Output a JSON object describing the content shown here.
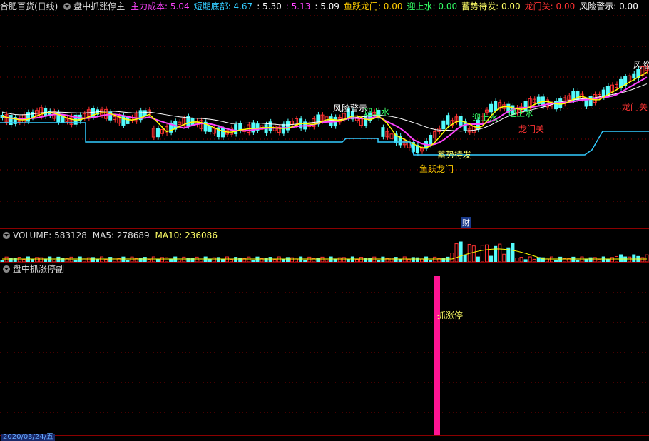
{
  "main_header": {
    "stock": "合肥百货(日线)",
    "indicator": "盘中抓涨停主",
    "items": [
      {
        "label": "主力成本:",
        "value": "5.04",
        "color": "#ff44ff"
      },
      {
        "label": "短期底部:",
        "value": "4.67",
        "color": "#33ccff"
      },
      {
        "label": ":",
        "value": "5.30",
        "color": "#ffffff"
      },
      {
        "label": ":",
        "value": "5.13",
        "color": "#ff44ff"
      },
      {
        "label": ":",
        "value": "5.09",
        "color": "#ffffff"
      },
      {
        "label": "鱼跃龙门:",
        "value": "0.00",
        "color": "#ffcc00"
      },
      {
        "label": "迎上水:",
        "value": "0.00",
        "color": "#33ff66"
      },
      {
        "label": "蓄势待发:",
        "value": "0.00",
        "color": "#ffff66"
      },
      {
        "label": "龙门关:",
        "value": "0.00",
        "color": "#ff3333"
      },
      {
        "label": "风险警示:",
        "value": "0.00",
        "color": "#ffffff"
      }
    ]
  },
  "volume_header": {
    "title": "VOLUME: 583128",
    "ma5": "MA5: 278689",
    "ma10": "MA10: 236086"
  },
  "sub_header": {
    "title": "盘中抓涨停副"
  },
  "signals": {
    "fengxian_1": "风险警示",
    "yingshangshui_1": "迎上水",
    "yingshangshui_2": "迎上水",
    "yingshangshui_3": "迎上水",
    "xushi": "蓄势待发",
    "yuyue": "鱼跃龙门",
    "longmen_1": "龙门关",
    "longmen_2": "龙门关",
    "fengxian_2": "风险",
    "cai": "财",
    "zhuazhangting": "抓涨停"
  },
  "date_label": "2020/03/24/五",
  "colors": {
    "up": "#ff3232",
    "down": "#54fcfc",
    "ma_white": "#ffffff",
    "ma_yellow": "#ffff00",
    "ma_magenta": "#ff44ff",
    "support": "#33ccff",
    "bar": "#ff1493",
    "grid": "#8b0000"
  }
}
